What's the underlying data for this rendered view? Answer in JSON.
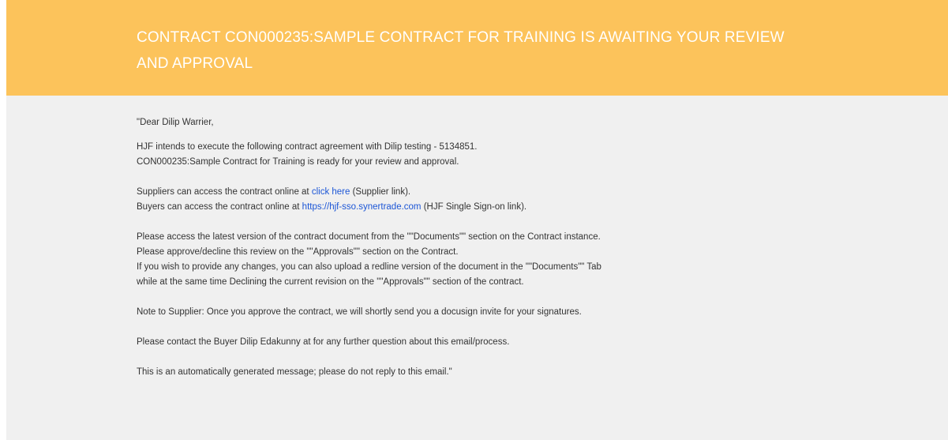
{
  "email": {
    "header_title": "CONTRACT CON000235:SAMPLE CONTRACT FOR TRAINING IS AWAITING YOUR REVIEW AND APPROVAL",
    "greeting": "\"Dear Dilip Warrier,",
    "intro": {
      "line1": "HJF intends to execute the following contract agreement with Dilip testing - 5134851.",
      "line2": "CON000235:Sample Contract for Training is ready for your review and approval."
    },
    "access": {
      "supplier_prefix": "Suppliers can access the contract online at ",
      "supplier_link": "click here",
      "supplier_suffix": " (Supplier link).",
      "buyer_prefix": "Buyers can access the contract online at ",
      "buyer_link": "https://hjf-sso.synertrade.com",
      "buyer_suffix": " (HJF Single Sign-on link)."
    },
    "instructions": {
      "line1": "Please access the latest version of the contract document from the \"\"Documents\"\" section on the Contract instance.",
      "line2": "Please approve/decline this review on the \"\"Approvals\"\" section on the Contract.",
      "line3": "If you wish to provide any changes, you can also upload a redline version of the document in the \"\"Documents\"\" Tab",
      "line4": "while at the same time Declining the current revision on the \"\"Approvals\"\" section of the contract."
    },
    "note": "Note to Supplier: Once you approve the contract, we will shortly send you a docusign invite for your signatures.",
    "contact": "Please contact the Buyer Dilip Edakunny at for any further question about this email/process.",
    "footer": "This is an automatically generated message; please do not reply to this email.\""
  },
  "colors": {
    "banner": "#fcc35b",
    "background": "#f0f0f0",
    "link": "#1c56d6"
  }
}
